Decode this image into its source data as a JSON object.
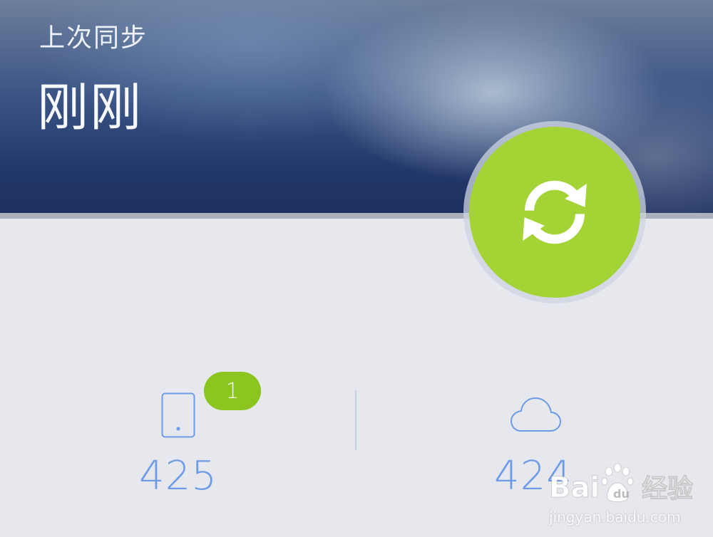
{
  "header": {
    "label": "上次同步",
    "time": "刚刚"
  },
  "sync_button": {
    "icon": "sync-icon",
    "color": "#a3d334"
  },
  "stats": {
    "local": {
      "icon": "phone-icon",
      "count": "425",
      "badge": "1"
    },
    "cloud": {
      "icon": "cloud-icon",
      "count": "424"
    }
  },
  "colors": {
    "accent_blue": "#6d9be6",
    "badge_green": "#8cc520",
    "background": "#e6e8ee"
  },
  "watermark": {
    "logo_text": "Bai du 经验",
    "url": "jingyan.baidu.com"
  }
}
